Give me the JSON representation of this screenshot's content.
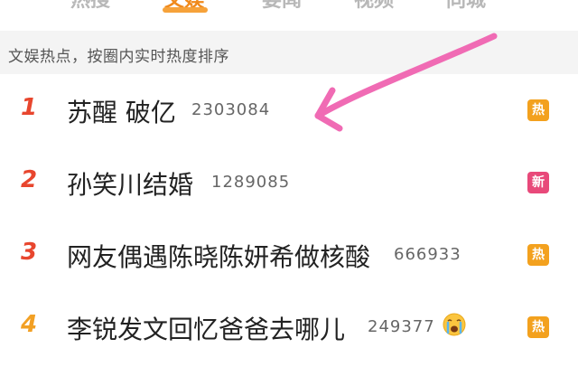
{
  "tabs": [
    {
      "label": "热搜",
      "active": false
    },
    {
      "label": "文娱",
      "active": true
    },
    {
      "label": "要闻",
      "active": false
    },
    {
      "label": "视频",
      "active": false
    },
    {
      "label": "同城",
      "active": false
    }
  ],
  "subhead": {
    "text": "文娱热点，按圈内实时热度排序"
  },
  "colors": {
    "rank_top": "#e8462e",
    "rank_fourth": "#f2a024",
    "badge_hot": "#f3a11e",
    "badge_new": "#e8497a",
    "annotation_arrow": "#f06bb4"
  },
  "items": [
    {
      "rank": "1",
      "title": "苏醒 破亿",
      "count": "2303084",
      "badge": "热",
      "badge_type": "hot"
    },
    {
      "rank": "2",
      "title": "孙笑川结婚",
      "count": "1289085",
      "badge": "新",
      "badge_type": "new"
    },
    {
      "rank": "3",
      "title": "网友偶遇陈晓陈妍希做核酸",
      "count": "666933",
      "badge": "热",
      "badge_type": "hot"
    },
    {
      "rank": "4",
      "title": "李锐发文回忆爸爸去哪儿",
      "count": "249377",
      "badge": "热",
      "badge_type": "hot",
      "emoji": "crying-face-icon"
    }
  ]
}
